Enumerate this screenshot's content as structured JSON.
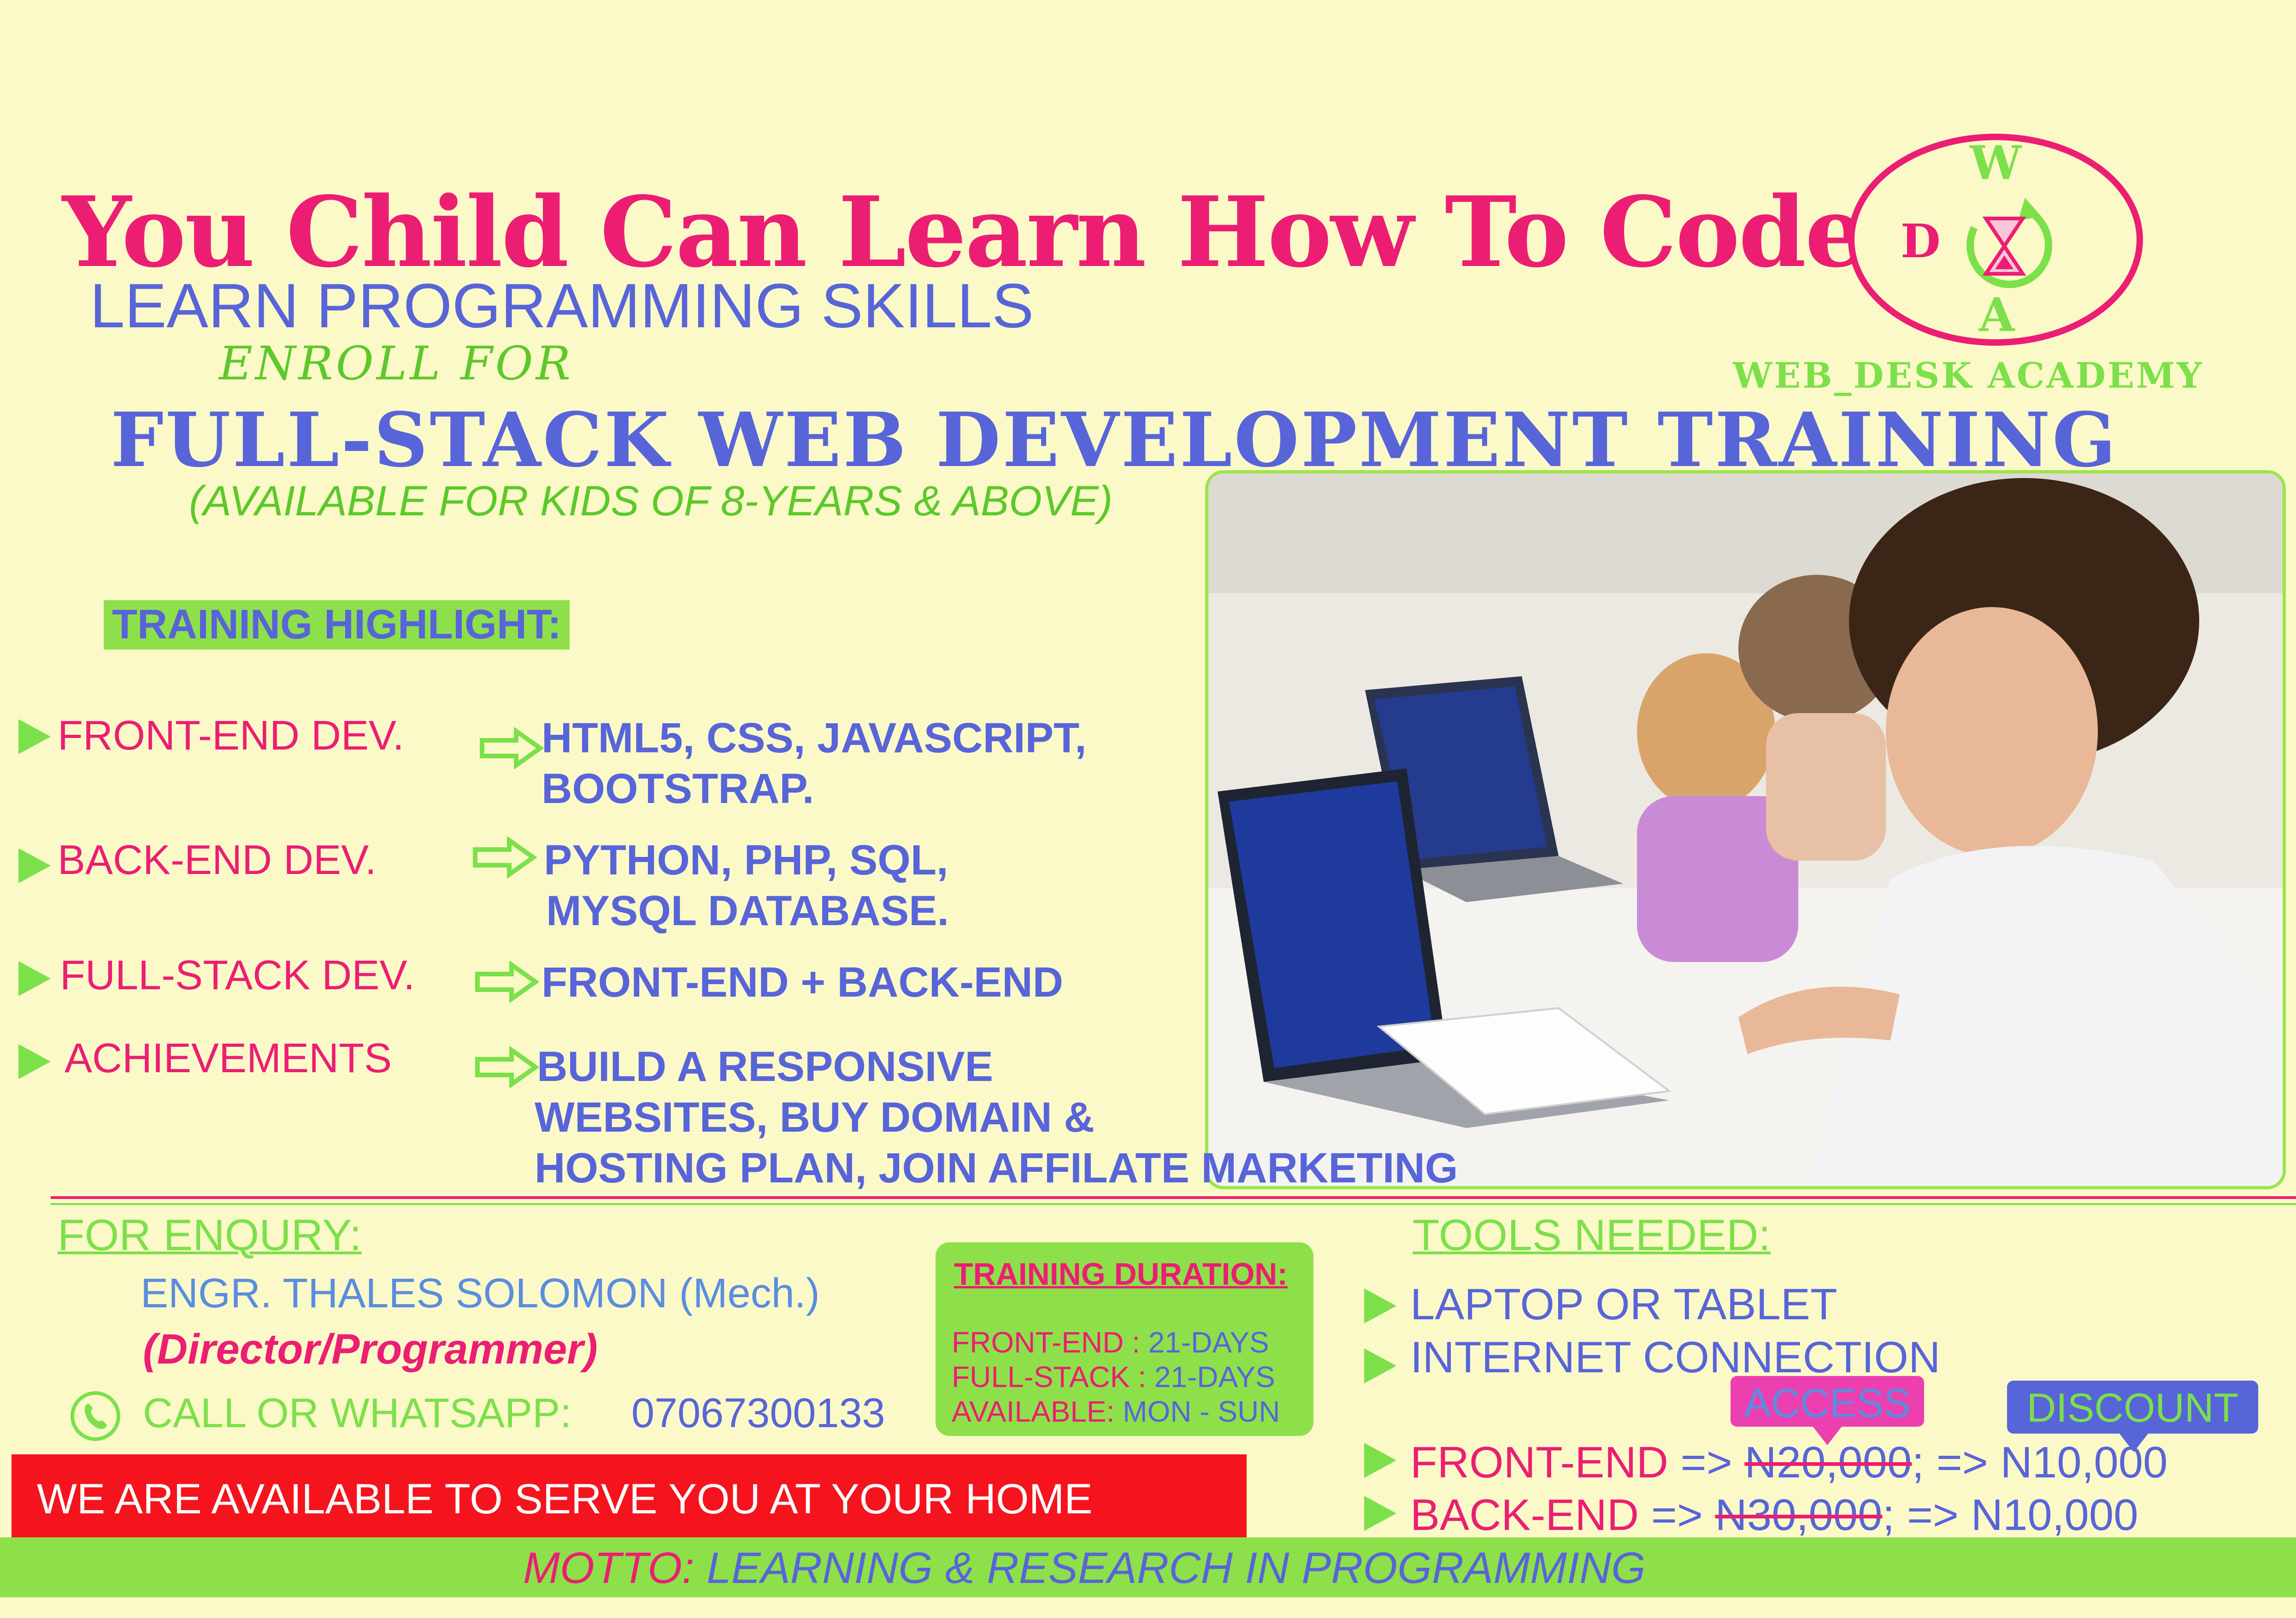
{
  "header": {
    "title": "You Child Can Learn How To Code",
    "subtitle": "LEARN PROGRAMMING SKILLS",
    "enroll": "ENROLL FOR",
    "main_heading": "FULL-STACK WEB DEVELOPMENT  TRAINING",
    "age_note": "(AVAILABLE FOR KIDS OF 8-YEARS & ABOVE)"
  },
  "logo": {
    "letters": {
      "top": "W",
      "left": "D",
      "bottom": "A"
    },
    "name": "WEB_DESK ACADEMY",
    "colors": {
      "ring": "#ec1e73",
      "green": "#7be04a"
    },
    "icons": [
      "hourglass-icon",
      "circular-arrow-icon"
    ]
  },
  "highlights": {
    "label": "TRAINING HIGHLIGHT:",
    "items": [
      {
        "label": "FRONT-END DEV.",
        "desc": [
          "HTML5, CSS, JAVASCRIPT,",
          "BOOTSTRAP."
        ]
      },
      {
        "label": "BACK-END DEV.",
        "desc": [
          "PYTHON, PHP, SQL,",
          "MYSQL DATABASE."
        ]
      },
      {
        "label": "FULL-STACK DEV.",
        "desc": [
          "FRONT-END + BACK-END"
        ]
      },
      {
        "label": "ACHIEVEMENTS",
        "desc": [
          "BUILD A RESPONSIVE",
          "WEBSITES, BUY DOMAIN &",
          "HOSTING PLAN, JOIN AFFILATE MARKETING"
        ]
      }
    ]
  },
  "enquiry": {
    "heading": "FOR ENQURY:",
    "name": "ENGR. THALES SOLOMON (Mech.)",
    "role": "(Director/Programmer)",
    "phone_label": "CALL OR WHATSAPP:",
    "phone_number": "07067300133"
  },
  "duration": {
    "heading": "TRAINING DURATION:",
    "lines": [
      {
        "label": "FRONT-END  :",
        "value": " 21-DAYS"
      },
      {
        "label": "FULL-STACK  :",
        "value": " 21-DAYS"
      },
      {
        "label": "AVAILABLE:",
        "value": " MON - SUN"
      }
    ]
  },
  "serve_banner": "WE ARE AVAILABLE TO SERVE YOU AT YOUR HOME",
  "tools": {
    "heading": "TOOLS NEEDED:",
    "items": [
      "LAPTOP OR TABLET",
      "INTERNET CONNECTION"
    ]
  },
  "pricing": {
    "access_label": "ACCESS",
    "discount_label": "DISCOUNT",
    "rows": [
      {
        "label": "FRONT-END",
        "arrow": " =>",
        "old": "N20,000",
        "sep": ";",
        "new": " => N10,000"
      },
      {
        "label": "BACK-END",
        "arrow": " =>",
        "old": "N30,000",
        "sep": ";",
        "new": "  => N10,000"
      }
    ]
  },
  "motto": {
    "label": "MOTTO:",
    "text": " LEARNING & RESEARCH IN PROGRAMMING"
  },
  "colors": {
    "background": "#fbf9c8",
    "pink": "#ec1e73",
    "blue": "#5865d8",
    "green": "#7be04a",
    "red": "#f5141e"
  }
}
